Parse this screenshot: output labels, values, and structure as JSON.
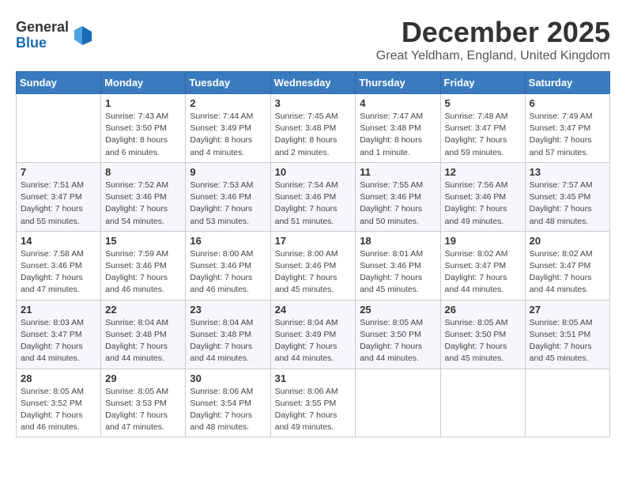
{
  "header": {
    "logo_general": "General",
    "logo_blue": "Blue",
    "month_title": "December 2025",
    "subtitle": "Great Yeldham, England, United Kingdom"
  },
  "days_of_week": [
    "Sunday",
    "Monday",
    "Tuesday",
    "Wednesday",
    "Thursday",
    "Friday",
    "Saturday"
  ],
  "weeks": [
    [
      {
        "day": "",
        "info": ""
      },
      {
        "day": "1",
        "info": "Sunrise: 7:43 AM\nSunset: 3:50 PM\nDaylight: 8 hours\nand 6 minutes."
      },
      {
        "day": "2",
        "info": "Sunrise: 7:44 AM\nSunset: 3:49 PM\nDaylight: 8 hours\nand 4 minutes."
      },
      {
        "day": "3",
        "info": "Sunrise: 7:45 AM\nSunset: 3:48 PM\nDaylight: 8 hours\nand 2 minutes."
      },
      {
        "day": "4",
        "info": "Sunrise: 7:47 AM\nSunset: 3:48 PM\nDaylight: 8 hours\nand 1 minute."
      },
      {
        "day": "5",
        "info": "Sunrise: 7:48 AM\nSunset: 3:47 PM\nDaylight: 7 hours\nand 59 minutes."
      },
      {
        "day": "6",
        "info": "Sunrise: 7:49 AM\nSunset: 3:47 PM\nDaylight: 7 hours\nand 57 minutes."
      }
    ],
    [
      {
        "day": "7",
        "info": "Sunrise: 7:51 AM\nSunset: 3:47 PM\nDaylight: 7 hours\nand 55 minutes."
      },
      {
        "day": "8",
        "info": "Sunrise: 7:52 AM\nSunset: 3:46 PM\nDaylight: 7 hours\nand 54 minutes."
      },
      {
        "day": "9",
        "info": "Sunrise: 7:53 AM\nSunset: 3:46 PM\nDaylight: 7 hours\nand 53 minutes."
      },
      {
        "day": "10",
        "info": "Sunrise: 7:54 AM\nSunset: 3:46 PM\nDaylight: 7 hours\nand 51 minutes."
      },
      {
        "day": "11",
        "info": "Sunrise: 7:55 AM\nSunset: 3:46 PM\nDaylight: 7 hours\nand 50 minutes."
      },
      {
        "day": "12",
        "info": "Sunrise: 7:56 AM\nSunset: 3:46 PM\nDaylight: 7 hours\nand 49 minutes."
      },
      {
        "day": "13",
        "info": "Sunrise: 7:57 AM\nSunset: 3:45 PM\nDaylight: 7 hours\nand 48 minutes."
      }
    ],
    [
      {
        "day": "14",
        "info": "Sunrise: 7:58 AM\nSunset: 3:46 PM\nDaylight: 7 hours\nand 47 minutes."
      },
      {
        "day": "15",
        "info": "Sunrise: 7:59 AM\nSunset: 3:46 PM\nDaylight: 7 hours\nand 46 minutes."
      },
      {
        "day": "16",
        "info": "Sunrise: 8:00 AM\nSunset: 3:46 PM\nDaylight: 7 hours\nand 46 minutes."
      },
      {
        "day": "17",
        "info": "Sunrise: 8:00 AM\nSunset: 3:46 PM\nDaylight: 7 hours\nand 45 minutes."
      },
      {
        "day": "18",
        "info": "Sunrise: 8:01 AM\nSunset: 3:46 PM\nDaylight: 7 hours\nand 45 minutes."
      },
      {
        "day": "19",
        "info": "Sunrise: 8:02 AM\nSunset: 3:47 PM\nDaylight: 7 hours\nand 44 minutes."
      },
      {
        "day": "20",
        "info": "Sunrise: 8:02 AM\nSunset: 3:47 PM\nDaylight: 7 hours\nand 44 minutes."
      }
    ],
    [
      {
        "day": "21",
        "info": "Sunrise: 8:03 AM\nSunset: 3:47 PM\nDaylight: 7 hours\nand 44 minutes."
      },
      {
        "day": "22",
        "info": "Sunrise: 8:04 AM\nSunset: 3:48 PM\nDaylight: 7 hours\nand 44 minutes."
      },
      {
        "day": "23",
        "info": "Sunrise: 8:04 AM\nSunset: 3:48 PM\nDaylight: 7 hours\nand 44 minutes."
      },
      {
        "day": "24",
        "info": "Sunrise: 8:04 AM\nSunset: 3:49 PM\nDaylight: 7 hours\nand 44 minutes."
      },
      {
        "day": "25",
        "info": "Sunrise: 8:05 AM\nSunset: 3:50 PM\nDaylight: 7 hours\nand 44 minutes."
      },
      {
        "day": "26",
        "info": "Sunrise: 8:05 AM\nSunset: 3:50 PM\nDaylight: 7 hours\nand 45 minutes."
      },
      {
        "day": "27",
        "info": "Sunrise: 8:05 AM\nSunset: 3:51 PM\nDaylight: 7 hours\nand 45 minutes."
      }
    ],
    [
      {
        "day": "28",
        "info": "Sunrise: 8:05 AM\nSunset: 3:52 PM\nDaylight: 7 hours\nand 46 minutes."
      },
      {
        "day": "29",
        "info": "Sunrise: 8:05 AM\nSunset: 3:53 PM\nDaylight: 7 hours\nand 47 minutes."
      },
      {
        "day": "30",
        "info": "Sunrise: 8:06 AM\nSunset: 3:54 PM\nDaylight: 7 hours\nand 48 minutes."
      },
      {
        "day": "31",
        "info": "Sunrise: 8:06 AM\nSunset: 3:55 PM\nDaylight: 7 hours\nand 49 minutes."
      },
      {
        "day": "",
        "info": ""
      },
      {
        "day": "",
        "info": ""
      },
      {
        "day": "",
        "info": ""
      }
    ]
  ]
}
